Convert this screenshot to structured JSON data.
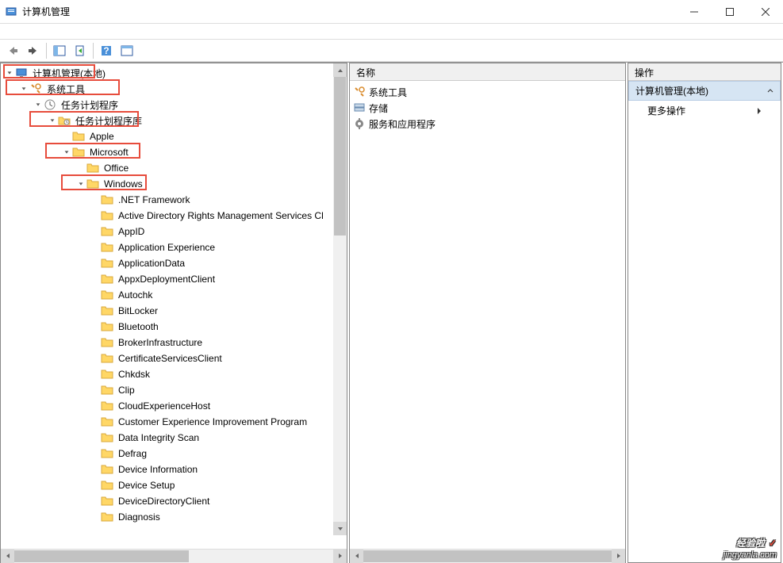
{
  "title": "计算机管理",
  "tree": {
    "root": "计算机管理(本地)",
    "systools": "系统工具",
    "scheduler": "任务计划程序",
    "schedlib": "任务计划程序库",
    "apple": "Apple",
    "microsoft": "Microsoft",
    "office": "Office",
    "windows": "Windows",
    "items": [
      ".NET Framework",
      "Active Directory Rights Management Services Cl",
      "AppID",
      "Application Experience",
      "ApplicationData",
      "AppxDeploymentClient",
      "Autochk",
      "BitLocker",
      "Bluetooth",
      "BrokerInfrastructure",
      "CertificateServicesClient",
      "Chkdsk",
      "Clip",
      "CloudExperienceHost",
      "Customer Experience Improvement Program",
      "Data Integrity Scan",
      "Defrag",
      "Device Information",
      "Device Setup",
      "DeviceDirectoryClient",
      "Diagnosis"
    ]
  },
  "list": {
    "header": "名称",
    "items": [
      "系统工具",
      "存储",
      "服务和应用程序"
    ]
  },
  "actions": {
    "header": "操作",
    "title": "计算机管理(本地)",
    "more": "更多操作"
  },
  "watermark": {
    "text": "经验啦",
    "url": "jingyanla.com"
  }
}
